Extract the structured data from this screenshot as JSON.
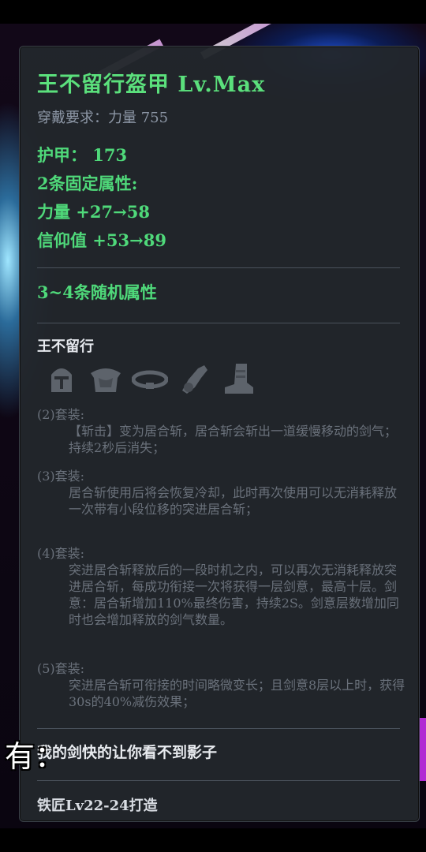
{
  "item": {
    "name_line": "王不留行盔甲  Lv.Max",
    "requirement": "穿戴要求：力量 755",
    "armor": "护甲：  173",
    "fixed_header": "2条固定属性:",
    "fixed_stats": [
      "力量  +27→58",
      "信仰值  +53→89"
    ],
    "random_header": "3~4条随机属性"
  },
  "set": {
    "name": "王不留行",
    "icons": [
      "helmet-icon",
      "chest-armor-icon",
      "belt-icon",
      "gauntlet-icon",
      "boots-icon"
    ],
    "bonuses": [
      {
        "label": "(2)套装:",
        "text": "【斩击】变为居合斩，居合斩会斩出一道缓慢移动的剑气；持续2秒后消失；"
      },
      {
        "label": "(3)套装:",
        "text": "居合斩使用后将会恢复冷却，此时再次使用可以无消耗释放一次带有小段位移的突进居合斩；"
      },
      {
        "label": "(4)套装:",
        "text": "突进居合斩释放后的一段时机之内，可以再次无消耗释放突进居合斩，每成功衔接一次将获得一层剑意，最高十层。剑意：居合斩增加110%最终伤害，持续2S。剑意层数增加同时也会增加释放的剑气数量。"
      },
      {
        "label": "(5)套装:",
        "text": "突进居合斩可衔接的时间略微变长；且剑意8层以上时，获得30s的40%减伤效果；"
      }
    ]
  },
  "flavor": "我的剑快的让你看不到影子",
  "crafting": "铁匠Lv22-24打造",
  "subtitle": "有："
}
